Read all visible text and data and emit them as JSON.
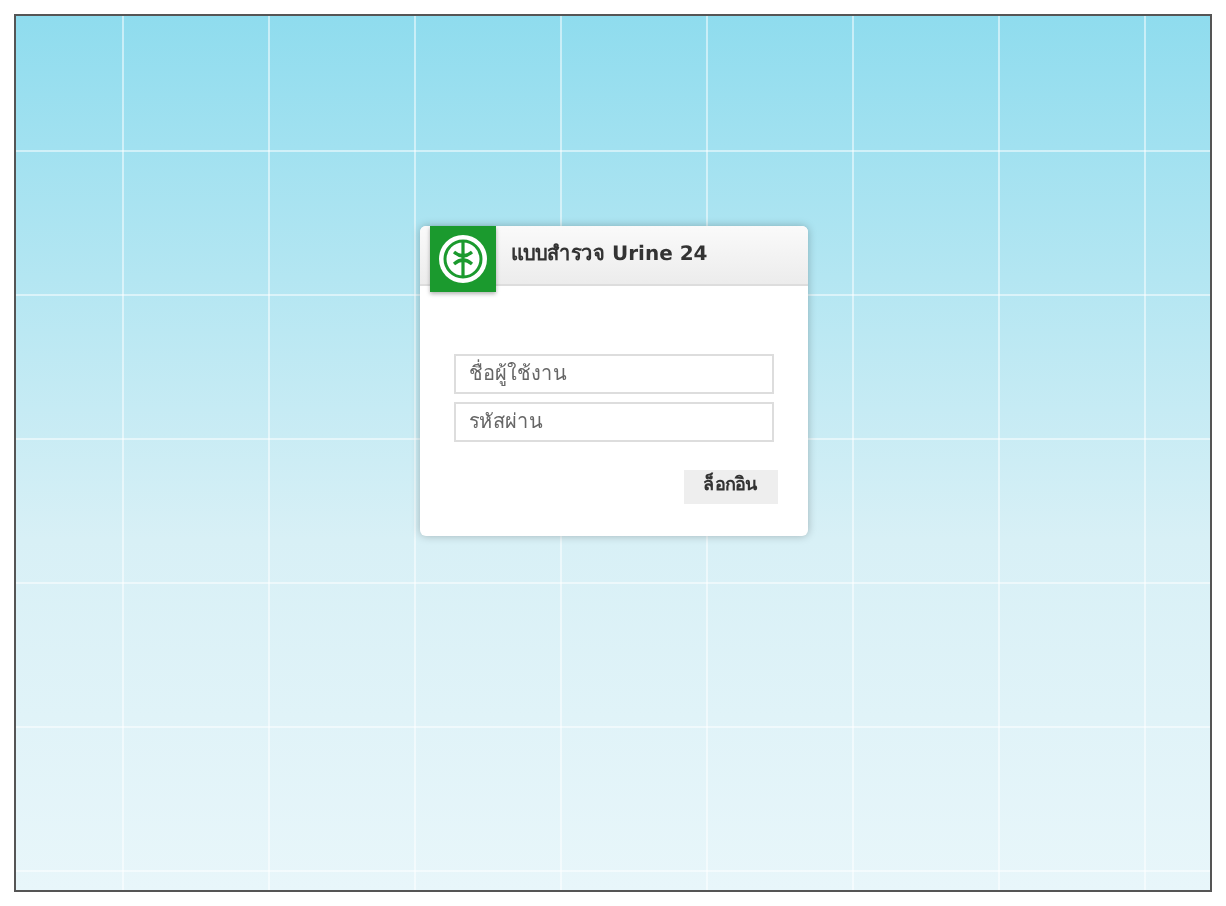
{
  "login": {
    "title": "แบบสำรวจ Urine 24",
    "fields": [
      {
        "placeholder": "ชื่อผู้ใช้งาน"
      },
      {
        "placeholder": "รหัสผ่าน"
      }
    ],
    "button": "ล็อกอิน"
  }
}
